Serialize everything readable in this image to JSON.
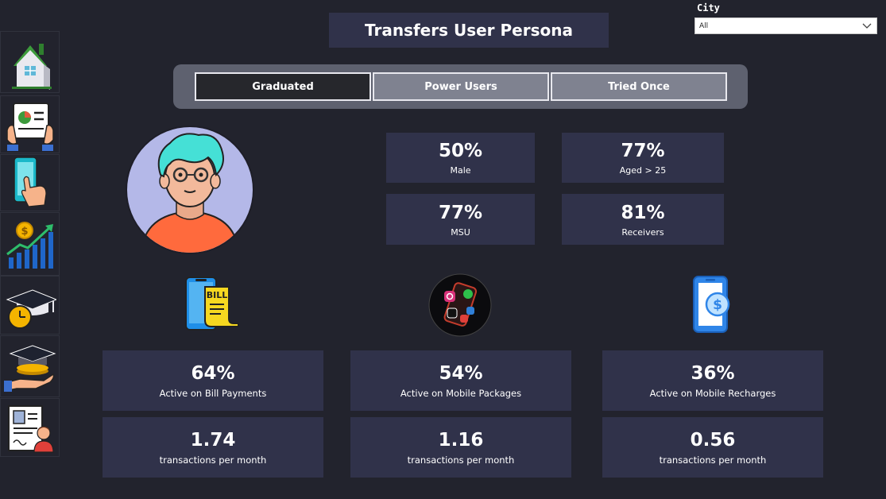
{
  "header": {
    "title": "Transfers User Persona"
  },
  "filter": {
    "label": "City",
    "value": "All"
  },
  "sidebar": {
    "items": [
      {
        "icon": "home-icon"
      },
      {
        "icon": "report-tablet-icon"
      },
      {
        "icon": "phone-tap-icon"
      },
      {
        "icon": "growth-chart-icon"
      },
      {
        "icon": "graduation-clock-icon"
      },
      {
        "icon": "graduation-hand-icon"
      },
      {
        "icon": "user-profile-doc-icon"
      }
    ]
  },
  "tabs": [
    {
      "label": "Graduated",
      "active": true
    },
    {
      "label": "Power Users",
      "active": false
    },
    {
      "label": "Tried Once",
      "active": false
    }
  ],
  "stats": [
    {
      "value": "50%",
      "label": "Male"
    },
    {
      "value": "77%",
      "label": "Aged > 25"
    },
    {
      "value": "77%",
      "label": "MSU"
    },
    {
      "value": "81%",
      "label": "Receivers"
    }
  ],
  "services": [
    {
      "icon": "bill-phone-icon",
      "active_value": "64%",
      "active_label": "Active on Bill Payments",
      "tx_value": "1.74",
      "tx_label": "transactions per month"
    },
    {
      "icon": "social-apps-phone-icon",
      "active_value": "54%",
      "active_label": "Active on Mobile Packages",
      "tx_value": "1.16",
      "tx_label": "transactions per month"
    },
    {
      "icon": "dollar-phone-icon",
      "active_value": "36%",
      "active_label": "Active on Mobile Recharges",
      "tx_value": "0.56",
      "tx_label": "transactions per month"
    }
  ],
  "colors": {
    "background": "#22232d",
    "card": "#30324a",
    "tab_active": "#26272c",
    "tab_inactive": "#7f8290"
  }
}
